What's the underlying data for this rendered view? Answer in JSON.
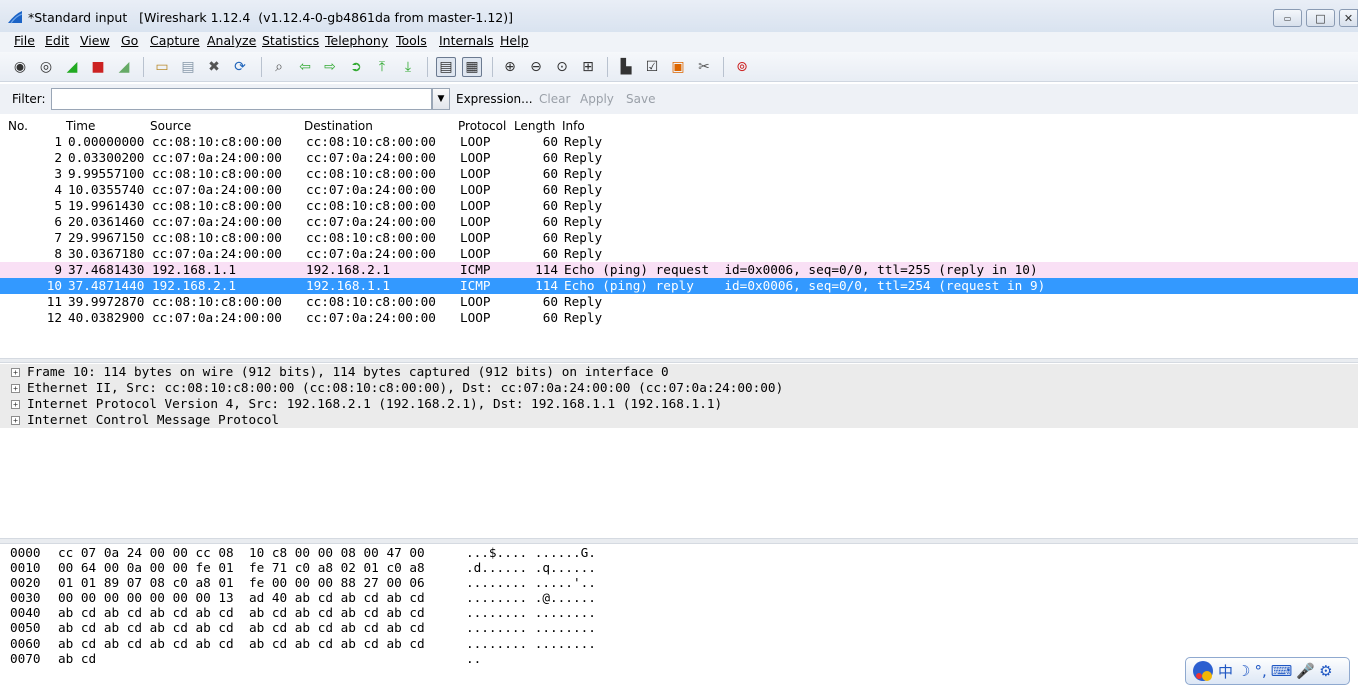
{
  "window": {
    "title": "*Standard input   [Wireshark 1.12.4  (v1.12.4-0-gb4861da from master-1.12)]",
    "controls": {
      "minimize": "▭",
      "maximize": "□",
      "close": "✕"
    }
  },
  "menu": [
    {
      "label": "File"
    },
    {
      "label": "Edit"
    },
    {
      "label": "View"
    },
    {
      "label": "Go"
    },
    {
      "label": "Capture"
    },
    {
      "label": "Analyze"
    },
    {
      "label": "Statistics"
    },
    {
      "label": "Telephony"
    },
    {
      "label": "Tools"
    },
    {
      "label": "Internals"
    },
    {
      "label": "Help"
    }
  ],
  "toolbar": {
    "icons": [
      {
        "name": "interfaces-icon",
        "glyph": "◉",
        "color": "#333333"
      },
      {
        "name": "options-icon",
        "glyph": "◎",
        "color": "#333333"
      },
      {
        "name": "start-capture-icon",
        "glyph": "◢",
        "color": "#22aa22"
      },
      {
        "name": "stop-capture-icon",
        "glyph": "■",
        "color": "#cc2222"
      },
      {
        "name": "restart-capture-icon",
        "glyph": "◢",
        "color": "#66aa66"
      },
      {
        "name": "open-file-icon",
        "glyph": "▭",
        "color": "#b88a2a"
      },
      {
        "name": "save-file-icon",
        "glyph": "▤",
        "color": "#8899aa"
      },
      {
        "name": "close-file-icon",
        "glyph": "✖",
        "color": "#555555"
      },
      {
        "name": "reload-icon",
        "glyph": "⟳",
        "color": "#2266bb"
      },
      {
        "name": "find-packet-icon",
        "glyph": "⌕",
        "color": "#555555"
      },
      {
        "name": "go-back-icon",
        "glyph": "⇦",
        "color": "#33aa33"
      },
      {
        "name": "go-forward-icon",
        "glyph": "⇨",
        "color": "#33aa33"
      },
      {
        "name": "go-to-packet-icon",
        "glyph": "➲",
        "color": "#33aa33"
      },
      {
        "name": "go-first-icon",
        "glyph": "⤒",
        "color": "#33aa33"
      },
      {
        "name": "go-last-icon",
        "glyph": "⤓",
        "color": "#33aa33"
      },
      {
        "name": "colorize-icon",
        "glyph": "▤",
        "color": "#333333"
      },
      {
        "name": "auto-scroll-icon",
        "glyph": "▦",
        "color": "#333333"
      },
      {
        "name": "zoom-in-icon",
        "glyph": "⊕",
        "color": "#333333"
      },
      {
        "name": "zoom-out-icon",
        "glyph": "⊖",
        "color": "#333333"
      },
      {
        "name": "zoom-normal-icon",
        "glyph": "⊙",
        "color": "#333333"
      },
      {
        "name": "resize-columns-icon",
        "glyph": "⊞",
        "color": "#333333"
      },
      {
        "name": "capture-filters-icon",
        "glyph": "▙",
        "color": "#333333"
      },
      {
        "name": "display-filters-icon",
        "glyph": "☑",
        "color": "#333333"
      },
      {
        "name": "coloring-rules-icon",
        "glyph": "▣",
        "color": "#dd6600"
      },
      {
        "name": "preferences-icon",
        "glyph": "✂",
        "color": "#555555"
      },
      {
        "name": "help-icon",
        "glyph": "⊚",
        "color": "#cc2222"
      }
    ]
  },
  "filter": {
    "label": "Filter:",
    "value": "",
    "expression": "Expression...",
    "clear": "Clear",
    "apply": "Apply",
    "save": "Save"
  },
  "packet_list": {
    "columns": [
      "No.",
      "Time",
      "Source",
      "Destination",
      "Protocol",
      "Length",
      "Info"
    ],
    "rows": [
      {
        "no": "1",
        "time": "0.00000000",
        "src": "cc:08:10:c8:00:00",
        "dst": "cc:08:10:c8:00:00",
        "proto": "LOOP",
        "len": "60",
        "info": "Reply",
        "style": "normal"
      },
      {
        "no": "2",
        "time": "0.03300200",
        "src": "cc:07:0a:24:00:00",
        "dst": "cc:07:0a:24:00:00",
        "proto": "LOOP",
        "len": "60",
        "info": "Reply",
        "style": "normal"
      },
      {
        "no": "3",
        "time": "9.99557100",
        "src": "cc:08:10:c8:00:00",
        "dst": "cc:08:10:c8:00:00",
        "proto": "LOOP",
        "len": "60",
        "info": "Reply",
        "style": "normal"
      },
      {
        "no": "4",
        "time": "10.0355740",
        "src": "cc:07:0a:24:00:00",
        "dst": "cc:07:0a:24:00:00",
        "proto": "LOOP",
        "len": "60",
        "info": "Reply",
        "style": "normal"
      },
      {
        "no": "5",
        "time": "19.9961430",
        "src": "cc:08:10:c8:00:00",
        "dst": "cc:08:10:c8:00:00",
        "proto": "LOOP",
        "len": "60",
        "info": "Reply",
        "style": "normal"
      },
      {
        "no": "6",
        "time": "20.0361460",
        "src": "cc:07:0a:24:00:00",
        "dst": "cc:07:0a:24:00:00",
        "proto": "LOOP",
        "len": "60",
        "info": "Reply",
        "style": "normal"
      },
      {
        "no": "7",
        "time": "29.9967150",
        "src": "cc:08:10:c8:00:00",
        "dst": "cc:08:10:c8:00:00",
        "proto": "LOOP",
        "len": "60",
        "info": "Reply",
        "style": "normal"
      },
      {
        "no": "8",
        "time": "30.0367180",
        "src": "cc:07:0a:24:00:00",
        "dst": "cc:07:0a:24:00:00",
        "proto": "LOOP",
        "len": "60",
        "info": "Reply",
        "style": "normal"
      },
      {
        "no": "9",
        "time": "37.4681430",
        "src": "192.168.1.1",
        "dst": "192.168.2.1",
        "proto": "ICMP",
        "len": "114",
        "info": "Echo (ping) request  id=0x0006, seq=0/0, ttl=255 (reply in 10)",
        "style": "pink"
      },
      {
        "no": "10",
        "time": "37.4871440",
        "src": "192.168.2.1",
        "dst": "192.168.1.1",
        "proto": "ICMP",
        "len": "114",
        "info": "Echo (ping) reply    id=0x0006, seq=0/0, ttl=254 (request in 9)",
        "style": "sel"
      },
      {
        "no": "11",
        "time": "39.9972870",
        "src": "cc:08:10:c8:00:00",
        "dst": "cc:08:10:c8:00:00",
        "proto": "LOOP",
        "len": "60",
        "info": "Reply",
        "style": "normal"
      },
      {
        "no": "12",
        "time": "40.0382900",
        "src": "cc:07:0a:24:00:00",
        "dst": "cc:07:0a:24:00:00",
        "proto": "LOOP",
        "len": "60",
        "info": "Reply",
        "style": "normal"
      }
    ]
  },
  "details": [
    "Frame 10: 114 bytes on wire (912 bits), 114 bytes captured (912 bits) on interface 0",
    "Ethernet II, Src: cc:08:10:c8:00:00 (cc:08:10:c8:00:00), Dst: cc:07:0a:24:00:00 (cc:07:0a:24:00:00)",
    "Internet Protocol Version 4, Src: 192.168.2.1 (192.168.2.1), Dst: 192.168.1.1 (192.168.1.1)",
    "Internet Control Message Protocol"
  ],
  "hex_dump": [
    {
      "offset": "0000",
      "hex": "cc 07 0a 24 00 00 cc 08  10 c8 00 00 08 00 47 00",
      "ascii": "...$.... ......G."
    },
    {
      "offset": "0010",
      "hex": "00 64 00 0a 00 00 fe 01  fe 71 c0 a8 02 01 c0 a8",
      "ascii": ".d...... .q......"
    },
    {
      "offset": "0020",
      "hex": "01 01 89 07 08 c0 a8 01  fe 00 00 00 88 27 00 06",
      "ascii": "........ .....'.."
    },
    {
      "offset": "0030",
      "hex": "00 00 00 00 00 00 00 13  ad 40 ab cd ab cd ab cd",
      "ascii": "........ .@......"
    },
    {
      "offset": "0040",
      "hex": "ab cd ab cd ab cd ab cd  ab cd ab cd ab cd ab cd",
      "ascii": "........ ........"
    },
    {
      "offset": "0050",
      "hex": "ab cd ab cd ab cd ab cd  ab cd ab cd ab cd ab cd",
      "ascii": "........ ........"
    },
    {
      "offset": "0060",
      "hex": "ab cd ab cd ab cd ab cd  ab cd ab cd ab cd ab cd",
      "ascii": "........ ........"
    },
    {
      "offset": "0070",
      "hex": "ab cd",
      "ascii": ".."
    }
  ],
  "ime": {
    "items": [
      "中",
      "☽",
      "°,",
      "⌨",
      "🎤",
      "⚙"
    ]
  }
}
